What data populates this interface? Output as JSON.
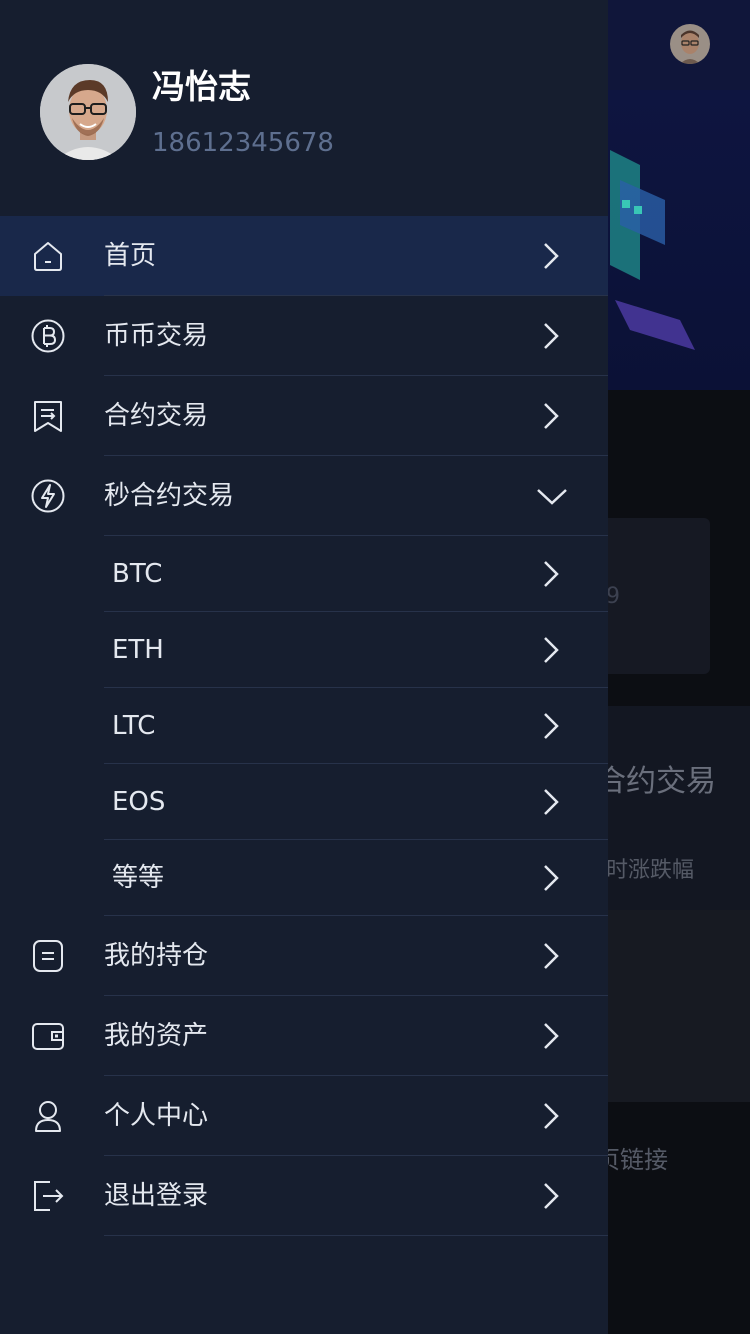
{
  "drawer": {
    "user": {
      "name": "冯怡志",
      "phone": "18612345678"
    },
    "menu": [
      {
        "id": "home",
        "label": "首页",
        "icon": "home-icon",
        "active": true
      },
      {
        "id": "spot",
        "label": "币币交易",
        "icon": "bitcoin-icon"
      },
      {
        "id": "contract",
        "label": "合约交易",
        "icon": "contract-icon"
      },
      {
        "id": "second",
        "label": "秒合约交易",
        "icon": "lightning-icon",
        "expanded": true
      }
    ],
    "submenu": [
      {
        "label": "BTC"
      },
      {
        "label": "ETH"
      },
      {
        "label": "LTC"
      },
      {
        "label": "EOS"
      },
      {
        "label": "等等"
      }
    ],
    "menu2": [
      {
        "id": "positions",
        "label": "我的持仓",
        "icon": "document-icon"
      },
      {
        "id": "assets",
        "label": "我的资产",
        "icon": "wallet-icon"
      },
      {
        "id": "profile",
        "label": "个人中心",
        "icon": "user-icon"
      },
      {
        "id": "logout",
        "label": "退出登录",
        "icon": "logout-icon"
      }
    ]
  },
  "background": {
    "card_number_fragment": "9",
    "section_title_fragment": "合约交易",
    "section_subtitle_fragment": "时涨跌幅",
    "link_fragment": "页链接"
  },
  "colors": {
    "drawer_bg": "#161e2f",
    "active_row": "#19284a",
    "text": "#e4e8ef",
    "phone": "#5e6f8f"
  }
}
